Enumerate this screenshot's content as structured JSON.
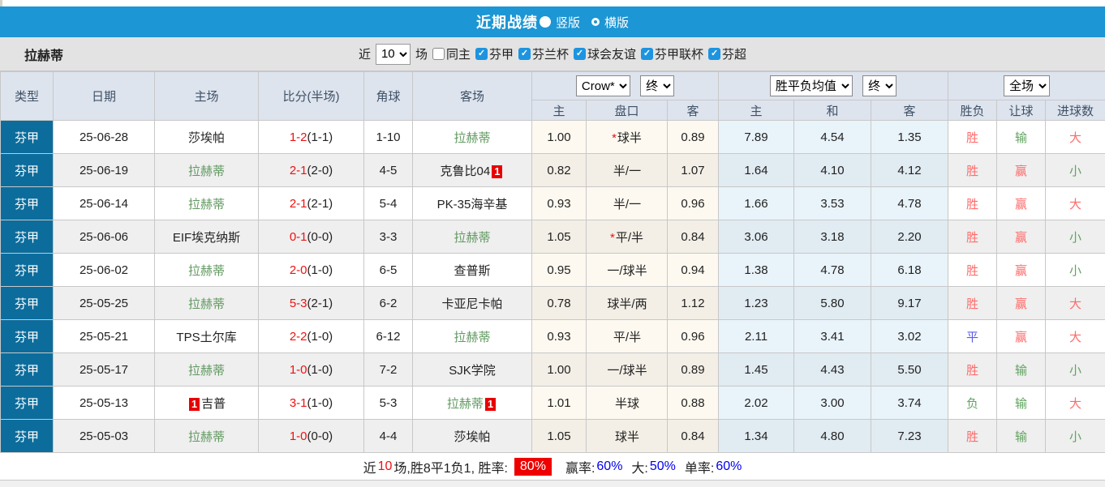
{
  "colors": {
    "title_bar_blue": "#1c96d4",
    "league_cell_blue": "#0c6d9c",
    "score_red": "#ee1111",
    "result_red": "#ff6b6b",
    "result_green": "#61a361",
    "result_blue": "#5b5bee",
    "team_green": "#619961",
    "summary_link_blue": "#0000ee",
    "badge_red": "#e80000"
  },
  "title_bar": {
    "title": "近期战绩",
    "radio_vertical": "竖版",
    "radio_horizontal": "横版"
  },
  "filter_bar": {
    "team": "拉赫蒂",
    "near_label": "近",
    "games_select": "10",
    "games_label": "场",
    "checkboxes": [
      {
        "label": "同主",
        "checked": false
      },
      {
        "label": "芬甲",
        "checked": true
      },
      {
        "label": "芬兰杯",
        "checked": true
      },
      {
        "label": "球会友谊",
        "checked": true
      },
      {
        "label": "芬甲联杯",
        "checked": true
      },
      {
        "label": "芬超",
        "checked": true
      }
    ]
  },
  "table": {
    "left_headers": [
      "类型",
      "日期",
      "主场",
      "比分(半场)",
      "角球",
      "客场"
    ],
    "group1": {
      "select1": "Crow*",
      "select2": "终",
      "cols": [
        "主",
        "盘口",
        "客"
      ]
    },
    "group2": {
      "select1": "胜平负均值",
      "select2": "终",
      "cols": [
        "主",
        "和",
        "客"
      ]
    },
    "group3": {
      "select1": "全场",
      "cols": [
        "胜负",
        "让球",
        "进球数"
      ]
    },
    "rows": [
      {
        "type": "芬甲",
        "date": "25-06-28",
        "home": {
          "name": "莎埃帕",
          "green": false
        },
        "score": "1-2",
        "half": "(1-1)",
        "corner": "1-10",
        "away": {
          "name": "拉赫蒂",
          "green": true
        },
        "odds": {
          "home": "1.00",
          "star": "*",
          "handicap": "球半",
          "away": "0.89"
        },
        "avg": {
          "home": "7.89",
          "draw": "4.54",
          "away": "1.35"
        },
        "results": {
          "wdl": {
            "text": "胜",
            "color": "red"
          },
          "handicap": {
            "text": "输",
            "color": "green"
          },
          "goals": {
            "text": "大",
            "color": "red"
          }
        }
      },
      {
        "type": "芬甲",
        "date": "25-06-19",
        "home": {
          "name": "拉赫蒂",
          "green": true
        },
        "score": "2-1",
        "half": "(2-0)",
        "corner": "4-5",
        "away": {
          "name": "克鲁比04",
          "green": false,
          "badge": "1",
          "badge_pos": "after"
        },
        "odds": {
          "home": "0.82",
          "star": "",
          "handicap": "半/一",
          "away": "1.07"
        },
        "avg": {
          "home": "1.64",
          "draw": "4.10",
          "away": "4.12"
        },
        "results": {
          "wdl": {
            "text": "胜",
            "color": "red"
          },
          "handicap": {
            "text": "赢",
            "color": "red"
          },
          "goals": {
            "text": "小",
            "color": "green"
          }
        }
      },
      {
        "type": "芬甲",
        "date": "25-06-14",
        "home": {
          "name": "拉赫蒂",
          "green": true
        },
        "score": "2-1",
        "half": "(2-1)",
        "corner": "5-4",
        "away": {
          "name": "PK-35海辛基",
          "green": false
        },
        "odds": {
          "home": "0.93",
          "star": "",
          "handicap": "半/一",
          "away": "0.96"
        },
        "avg": {
          "home": "1.66",
          "draw": "3.53",
          "away": "4.78"
        },
        "results": {
          "wdl": {
            "text": "胜",
            "color": "red"
          },
          "handicap": {
            "text": "赢",
            "color": "red"
          },
          "goals": {
            "text": "大",
            "color": "red"
          }
        }
      },
      {
        "type": "芬甲",
        "date": "25-06-06",
        "home": {
          "name": "EIF埃克纳斯",
          "green": false
        },
        "score": "0-1",
        "half": "(0-0)",
        "corner": "3-3",
        "away": {
          "name": "拉赫蒂",
          "green": true
        },
        "odds": {
          "home": "1.05",
          "star": "*",
          "handicap": "平/半",
          "away": "0.84"
        },
        "avg": {
          "home": "3.06",
          "draw": "3.18",
          "away": "2.20"
        },
        "results": {
          "wdl": {
            "text": "胜",
            "color": "red"
          },
          "handicap": {
            "text": "赢",
            "color": "red"
          },
          "goals": {
            "text": "小",
            "color": "green"
          }
        }
      },
      {
        "type": "芬甲",
        "date": "25-06-02",
        "home": {
          "name": "拉赫蒂",
          "green": true
        },
        "score": "2-0",
        "half": "(1-0)",
        "corner": "6-5",
        "away": {
          "name": "查普斯",
          "green": false
        },
        "odds": {
          "home": "0.95",
          "star": "",
          "handicap": "一/球半",
          "away": "0.94"
        },
        "avg": {
          "home": "1.38",
          "draw": "4.78",
          "away": "6.18"
        },
        "results": {
          "wdl": {
            "text": "胜",
            "color": "red"
          },
          "handicap": {
            "text": "赢",
            "color": "red"
          },
          "goals": {
            "text": "小",
            "color": "green"
          }
        }
      },
      {
        "type": "芬甲",
        "date": "25-05-25",
        "home": {
          "name": "拉赫蒂",
          "green": true
        },
        "score": "5-3",
        "half": "(2-1)",
        "corner": "6-2",
        "away": {
          "name": "卡亚尼卡帕",
          "green": false
        },
        "odds": {
          "home": "0.78",
          "star": "",
          "handicap": "球半/两",
          "away": "1.12"
        },
        "avg": {
          "home": "1.23",
          "draw": "5.80",
          "away": "9.17"
        },
        "results": {
          "wdl": {
            "text": "胜",
            "color": "red"
          },
          "handicap": {
            "text": "赢",
            "color": "red"
          },
          "goals": {
            "text": "大",
            "color": "red"
          }
        }
      },
      {
        "type": "芬甲",
        "date": "25-05-21",
        "home": {
          "name": "TPS土尔库",
          "green": false
        },
        "score": "2-2",
        "half": "(1-0)",
        "corner": "6-12",
        "away": {
          "name": "拉赫蒂",
          "green": true
        },
        "odds": {
          "home": "0.93",
          "star": "",
          "handicap": "平/半",
          "away": "0.96"
        },
        "avg": {
          "home": "2.11",
          "draw": "3.41",
          "away": "3.02"
        },
        "results": {
          "wdl": {
            "text": "平",
            "color": "blue"
          },
          "handicap": {
            "text": "赢",
            "color": "red"
          },
          "goals": {
            "text": "大",
            "color": "red"
          }
        }
      },
      {
        "type": "芬甲",
        "date": "25-05-17",
        "home": {
          "name": "拉赫蒂",
          "green": true
        },
        "score": "1-0",
        "half": "(1-0)",
        "corner": "7-2",
        "away": {
          "name": "SJK学院",
          "green": false
        },
        "odds": {
          "home": "1.00",
          "star": "",
          "handicap": "一/球半",
          "away": "0.89"
        },
        "avg": {
          "home": "1.45",
          "draw": "4.43",
          "away": "5.50"
        },
        "results": {
          "wdl": {
            "text": "胜",
            "color": "red"
          },
          "handicap": {
            "text": "输",
            "color": "green"
          },
          "goals": {
            "text": "小",
            "color": "green"
          }
        }
      },
      {
        "type": "芬甲",
        "date": "25-05-13",
        "home": {
          "name": "吉普",
          "green": false,
          "badge": "1",
          "badge_pos": "before"
        },
        "score": "3-1",
        "half": "(1-0)",
        "corner": "5-3",
        "away": {
          "name": "拉赫蒂",
          "green": true,
          "badge": "1",
          "badge_pos": "after"
        },
        "odds": {
          "home": "1.01",
          "star": "",
          "handicap": "半球",
          "away": "0.88"
        },
        "avg": {
          "home": "2.02",
          "draw": "3.00",
          "away": "3.74"
        },
        "results": {
          "wdl": {
            "text": "负",
            "color": "green"
          },
          "handicap": {
            "text": "输",
            "color": "green"
          },
          "goals": {
            "text": "大",
            "color": "red"
          }
        }
      },
      {
        "type": "芬甲",
        "date": "25-05-03",
        "home": {
          "name": "拉赫蒂",
          "green": true
        },
        "score": "1-0",
        "half": "(0-0)",
        "corner": "4-4",
        "away": {
          "name": "莎埃帕",
          "green": false
        },
        "odds": {
          "home": "1.05",
          "star": "",
          "handicap": "球半",
          "away": "0.84"
        },
        "avg": {
          "home": "1.34",
          "draw": "4.80",
          "away": "7.23"
        },
        "results": {
          "wdl": {
            "text": "胜",
            "color": "red"
          },
          "handicap": {
            "text": "输",
            "color": "green"
          },
          "goals": {
            "text": "小",
            "color": "green"
          }
        }
      }
    ]
  },
  "summary": {
    "prefix": "近",
    "count": "10",
    "mid": "场,胜8平1负1, 胜率:",
    "win_rate": "80%",
    "ying_label": "赢率:",
    "ying_value": "60%",
    "da_label": "大:",
    "da_value": "50%",
    "dan_label": "单率:",
    "dan_value": "60%"
  }
}
